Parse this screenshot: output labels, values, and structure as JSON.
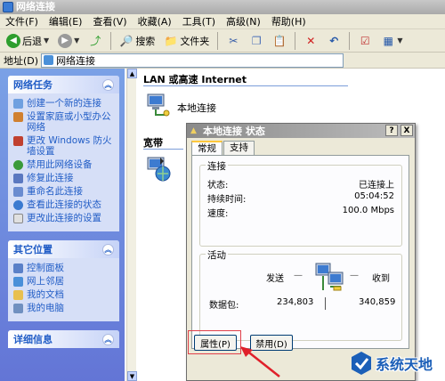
{
  "window": {
    "title": "网络连接"
  },
  "menu": [
    "文件(F)",
    "编辑(E)",
    "查看(V)",
    "收藏(A)",
    "工具(T)",
    "高级(N)",
    "帮助(H)"
  ],
  "toolbar": {
    "back": "后退",
    "search": "搜索",
    "folders": "文件夹"
  },
  "address": {
    "label": "地址(D)",
    "value": "网络连接"
  },
  "left_pane": {
    "network_tasks": {
      "title": "网络任务",
      "items": [
        "创建一个新的连接",
        "设置家庭或小型办公网络",
        "更改 Windows 防火墙设置",
        "禁用此网络设备",
        "修复此连接",
        "重命名此连接",
        "查看此连接的状态",
        "更改此连接的设置"
      ]
    },
    "other_places": {
      "title": "其它位置",
      "items": [
        "控制面板",
        "网上邻居",
        "我的文档",
        "我的电脑"
      ]
    },
    "details": {
      "title": "详细信息"
    }
  },
  "content": {
    "group_lan": "LAN 或高速 Internet",
    "lan_item": "本地连接",
    "group_broadband": "宽带"
  },
  "dialog": {
    "title": "本地连接 状态",
    "tabs": [
      "常规",
      "支持"
    ],
    "connection": {
      "label": "连接",
      "status_label": "状态:",
      "status_value": "已连接上",
      "duration_label": "持续时间:",
      "duration_value": "05:04:52",
      "speed_label": "速度:",
      "speed_value": "100.0 Mbps"
    },
    "activity": {
      "label": "活动",
      "sent_label": "发送",
      "received_label": "收到",
      "packets_label": "数据包:",
      "sent_value": "234,803",
      "received_value": "340,859"
    },
    "buttons": {
      "properties": "属性(P)",
      "disable": "禁用(D)"
    },
    "controls": {
      "help": "?",
      "close": "X"
    }
  },
  "watermark": {
    "text": "系统天地"
  }
}
